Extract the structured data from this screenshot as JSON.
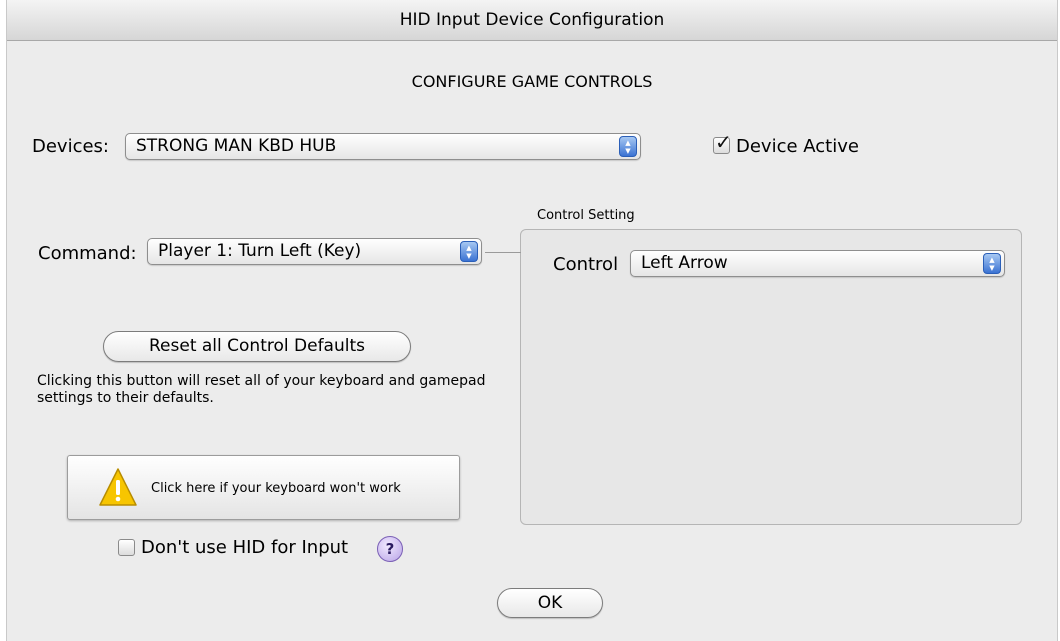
{
  "window": {
    "title": "HID Input Device Configuration"
  },
  "heading": "CONFIGURE GAME CONTROLS",
  "devices": {
    "label": "Devices:",
    "selected": "STRONG MAN KBD HUB",
    "device_active_label": "Device Active",
    "device_active_checked": true
  },
  "command": {
    "label": "Command:",
    "selected": "Player 1:  Turn Left (Key)"
  },
  "control_setting": {
    "group_title": "Control Setting",
    "control_label": "Control",
    "control_selected": "Left Arrow"
  },
  "reset": {
    "button_label": "Reset all Control Defaults",
    "note": "Clicking this button will reset all of your keyboard and gamepad settings to their defaults."
  },
  "warning_button": {
    "label": "Click here if your keyboard won't work",
    "icon": "warning-triangle-icon"
  },
  "dont_use_hid": {
    "label": "Don't use HID for Input",
    "checked": false
  },
  "help": {
    "label": "?"
  },
  "ok_button": {
    "label": "OK"
  }
}
